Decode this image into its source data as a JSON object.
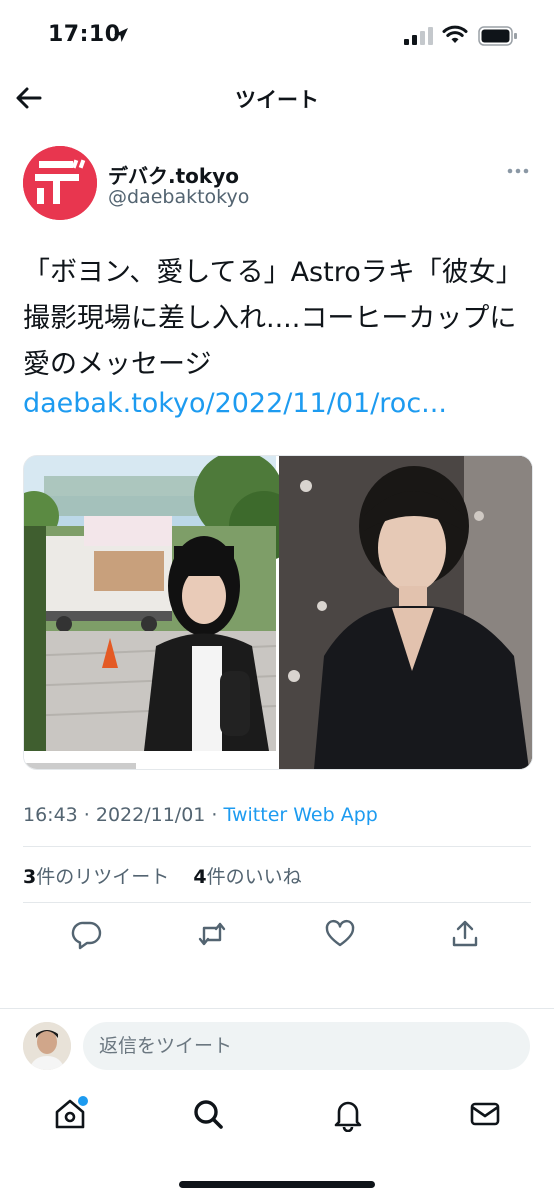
{
  "status_bar": {
    "time": "17:10",
    "icons": [
      "location-arrow-icon",
      "signal-icon",
      "wifi-icon",
      "battery-icon"
    ]
  },
  "header": {
    "title": "ツイート",
    "back_icon": "back-arrow-icon"
  },
  "tweet": {
    "author_name": "デバク.tokyo",
    "author_handle": "@daebaktokyo",
    "text": "「ボヨン、愛してる」Astroラキ「彼女」撮影現場に差し入れ....コーヒーカップに愛のメッセージ",
    "link": "daebak.tokyo/2022/11/01/roc...",
    "timestamp": "16:43 · 2022/11/01 · ",
    "source_app": "Twitter Web App",
    "retweets_count": "3",
    "retweets_label": "件のリツイート",
    "likes_count": "4",
    "likes_label": "件のいいね",
    "media": [
      "photo-coffee-truck-actress",
      "photo-man-black-shirt"
    ]
  },
  "actions": [
    "reply-icon",
    "retweet-icon",
    "like-icon",
    "share-icon"
  ],
  "reply": {
    "placeholder": "返信をツイート"
  },
  "tab_bar": {
    "items": [
      "home-icon",
      "search-icon",
      "notifications-icon",
      "messages-icon"
    ]
  },
  "colors": {
    "accent": "#1d9bf0",
    "brand_logo": "#e8364f",
    "text": "#0f1419",
    "secondary_text": "#536471"
  }
}
